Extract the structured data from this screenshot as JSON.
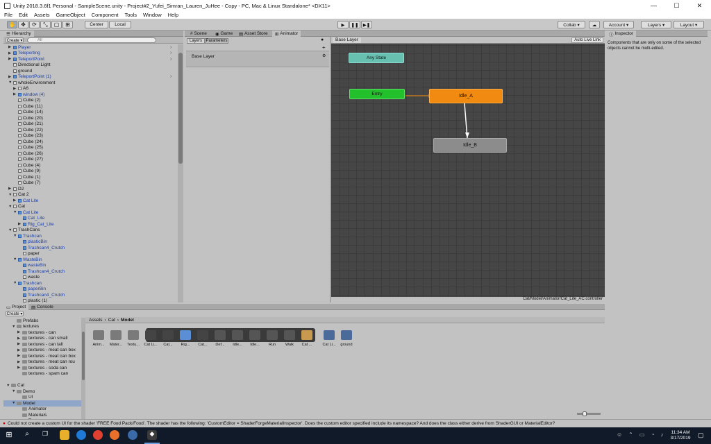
{
  "window": {
    "title": "Unity 2018.3.6f1 Personal - SampleScene.unity - Project#2_Yufei_Simran_Lauren_JuHee - Copy - PC, Mac & Linux Standalone* <DX11>",
    "minimize": "—",
    "maximize": "☐",
    "close": "✕"
  },
  "menu": [
    "File",
    "Edit",
    "Assets",
    "GameObject",
    "Component",
    "Tools",
    "Window",
    "Help"
  ],
  "toolbar": {
    "tools": [
      "✋",
      "✥",
      "⟳",
      "⤡",
      "▢",
      "⊞"
    ],
    "center": "Center",
    "local": "Local",
    "play": "▶",
    "pause": "❚❚",
    "step": "▶❚",
    "collab": "Collab ▾",
    "account": "Account ▾",
    "layers": "Layers ▾",
    "layout": "Layout ▾"
  },
  "hierarchy": {
    "tab": "Hierarchy",
    "create": "Create ▾",
    "search_placeholder": "All",
    "rows": [
      {
        "t": "Player",
        "d": 1,
        "a": "▶",
        "b": true
      },
      {
        "t": "Teleporting",
        "d": 1,
        "a": "▶",
        "b": true
      },
      {
        "t": "TeleportPoint",
        "d": 1,
        "a": "▶",
        "b": true
      },
      {
        "t": "Directional Light",
        "d": 1,
        "a": "",
        "b": false
      },
      {
        "t": "ground",
        "d": 1,
        "a": "",
        "b": false
      },
      {
        "t": "TeleportPoint (1)",
        "d": 1,
        "a": "▶",
        "b": true
      },
      {
        "t": "wholeEnvironment",
        "d": 1,
        "a": "▼",
        "b": false
      },
      {
        "t": "A6",
        "d": 2,
        "a": "▶",
        "b": false
      },
      {
        "t": "window (4)",
        "d": 2,
        "a": "▶",
        "b": true
      },
      {
        "t": "Cube (2)",
        "d": 2,
        "a": "",
        "b": false
      },
      {
        "t": "Cube (11)",
        "d": 2,
        "a": "",
        "b": false
      },
      {
        "t": "Cube (14)",
        "d": 2,
        "a": "",
        "b": false
      },
      {
        "t": "Cube (20)",
        "d": 2,
        "a": "",
        "b": false
      },
      {
        "t": "Cube (21)",
        "d": 2,
        "a": "",
        "b": false
      },
      {
        "t": "Cube (22)",
        "d": 2,
        "a": "",
        "b": false
      },
      {
        "t": "Cube (23)",
        "d": 2,
        "a": "",
        "b": false
      },
      {
        "t": "Cube (24)",
        "d": 2,
        "a": "",
        "b": false
      },
      {
        "t": "Cube (25)",
        "d": 2,
        "a": "",
        "b": false
      },
      {
        "t": "Cube (26)",
        "d": 2,
        "a": "",
        "b": false
      },
      {
        "t": "Cube (27)",
        "d": 2,
        "a": "",
        "b": false
      },
      {
        "t": "Cube (4)",
        "d": 2,
        "a": "",
        "b": false
      },
      {
        "t": "Cube (9)",
        "d": 2,
        "a": "",
        "b": false
      },
      {
        "t": "Cube (1)",
        "d": 2,
        "a": "",
        "b": false
      },
      {
        "t": "Cube (7)",
        "d": 2,
        "a": "",
        "b": false
      },
      {
        "t": "D2",
        "d": 1,
        "a": "▶",
        "b": false
      },
      {
        "t": "Cat 2",
        "d": 1,
        "a": "▼",
        "b": false
      },
      {
        "t": "Cat Lite",
        "d": 2,
        "a": "▶",
        "b": true
      },
      {
        "t": "Cat",
        "d": 1,
        "a": "▼",
        "b": false
      },
      {
        "t": "Cat Lite",
        "d": 2,
        "a": "▼",
        "b": true
      },
      {
        "t": "Cat_Lite",
        "d": 3,
        "a": "",
        "b": true
      },
      {
        "t": "Rig_Cat_Lite",
        "d": 3,
        "a": "▶",
        "b": true
      },
      {
        "t": "TrashCans",
        "d": 1,
        "a": "▼",
        "b": false
      },
      {
        "t": "Trashcan",
        "d": 2,
        "a": "▼",
        "b": true
      },
      {
        "t": "plasticBin",
        "d": 3,
        "a": "",
        "b": true
      },
      {
        "t": "Trashcan4_Crutch",
        "d": 3,
        "a": "",
        "b": true
      },
      {
        "t": "paper",
        "d": 3,
        "a": "",
        "b": false
      },
      {
        "t": "WasteBin",
        "d": 2,
        "a": "▼",
        "b": true
      },
      {
        "t": "wasteBin",
        "d": 3,
        "a": "",
        "b": true
      },
      {
        "t": "Trashcan4_Crutch",
        "d": 3,
        "a": "",
        "b": true
      },
      {
        "t": "waste",
        "d": 3,
        "a": "",
        "b": false
      },
      {
        "t": "Trashcan",
        "d": 2,
        "a": "▼",
        "b": true
      },
      {
        "t": "paperBin",
        "d": 3,
        "a": "",
        "b": true
      },
      {
        "t": "Trashcan4_Crutch",
        "d": 3,
        "a": "",
        "b": true
      },
      {
        "t": "plastic (1)",
        "d": 3,
        "a": "",
        "b": false
      }
    ]
  },
  "center_tabs": [
    "Scene",
    "Game",
    "Asset Store",
    "Animator"
  ],
  "animator": {
    "layers_tab": "Layers",
    "parameters_tab": "Parameters",
    "add": "+",
    "base_layer_item": "Base Layer",
    "breadcrumb": "Base Layer",
    "auto_live_link": "Auto Live Link",
    "path": "Cat/Model/Animator/Cat_Lite_AC.controller",
    "states": {
      "any": "Any State",
      "entry": "Entry",
      "idle_a": "Idle_A",
      "idle_b": "Idle_B"
    }
  },
  "inspector": {
    "tab": "Inspector",
    "message": "Components that are only on some of the selected objects cannot be multi-edited."
  },
  "project": {
    "tab": "Project",
    "console_tab": "Console",
    "create": "Create ▾",
    "tree": [
      {
        "t": "Prefabs",
        "d": 1,
        "a": ""
      },
      {
        "t": "textures",
        "d": 1,
        "a": "▼"
      },
      {
        "t": "textures - can",
        "d": 2,
        "a": "▶"
      },
      {
        "t": "textures - can small",
        "d": 2,
        "a": "▶"
      },
      {
        "t": "textures - can tall",
        "d": 2,
        "a": "▶"
      },
      {
        "t": "textures - meat can box",
        "d": 2,
        "a": "▶"
      },
      {
        "t": "textures - meat can box",
        "d": 2,
        "a": "▶"
      },
      {
        "t": "textures - meat can rou",
        "d": 2,
        "a": "▶"
      },
      {
        "t": "textures - soda can",
        "d": 2,
        "a": "▶"
      },
      {
        "t": "textures - spam can",
        "d": 2,
        "a": ""
      },
      {
        "t": "",
        "d": 1,
        "a": ""
      },
      {
        "t": "Cat",
        "d": 0,
        "a": "▼"
      },
      {
        "t": "Demo",
        "d": 1,
        "a": "▼"
      },
      {
        "t": "UI",
        "d": 2,
        "a": ""
      },
      {
        "t": "Model",
        "d": 1,
        "a": "▼",
        "sel": true
      },
      {
        "t": "Animator",
        "d": 2,
        "a": ""
      },
      {
        "t": "Materials",
        "d": 2,
        "a": ""
      },
      {
        "t": "Textures",
        "d": 2,
        "a": ""
      }
    ],
    "breadcrumb": [
      "Assets",
      "Cat",
      "Model"
    ],
    "assets": [
      "Anim...",
      "Mater...",
      "Textu...",
      "Cat Li...",
      "Cat...",
      "Rig...",
      "Cat...",
      "Def...",
      "Idle...",
      "Idle...",
      "Run",
      "Walk",
      "Cat ...",
      "Cat Li...",
      "ground"
    ]
  },
  "status": {
    "text": "Could not create a custom UI for the shader 'FREE Food Pack/Food'. The shader has the following: 'CustomEditor = ShaderForgeMaterialInspector'. Does the custom editor specified include its namespace? And does the class either derive from ShaderGUI or MaterialEditor?"
  },
  "taskbar": {
    "time": "11:34 AM",
    "date": "3/17/2019"
  }
}
